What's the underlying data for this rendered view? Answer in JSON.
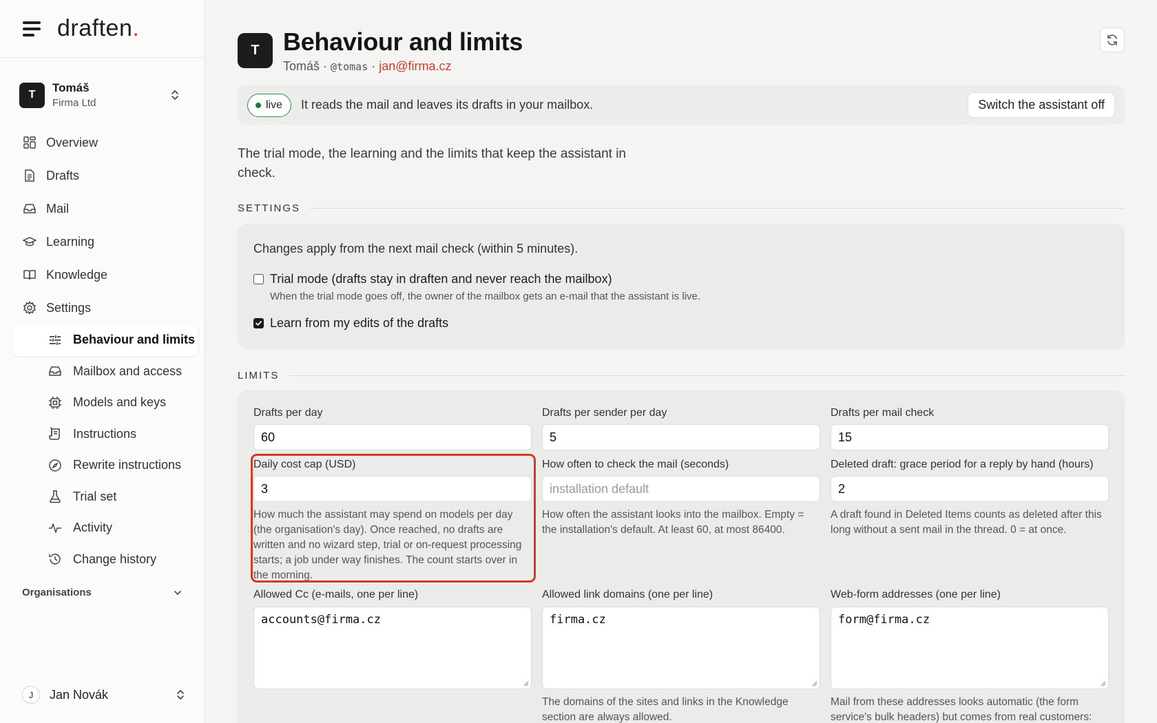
{
  "brand": {
    "name": "draften",
    "dot": ".",
    "accent": "#c8402b"
  },
  "account": {
    "initial": "T",
    "name": "Tomáš",
    "org": "Firma Ltd"
  },
  "nav": [
    {
      "label": "Overview",
      "icon": "grid-icon"
    },
    {
      "label": "Drafts",
      "icon": "document-icon"
    },
    {
      "label": "Mail",
      "icon": "inbox-icon"
    },
    {
      "label": "Learning",
      "icon": "graduation-cap-icon"
    },
    {
      "label": "Knowledge",
      "icon": "book-icon"
    },
    {
      "label": "Settings",
      "icon": "gear-icon"
    }
  ],
  "settings_nav": [
    {
      "label": "Behaviour and limits",
      "icon": "sliders-icon",
      "active": true
    },
    {
      "label": "Mailbox and access",
      "icon": "inbox-icon"
    },
    {
      "label": "Models and keys",
      "icon": "cpu-icon"
    },
    {
      "label": "Instructions",
      "icon": "scroll-icon"
    },
    {
      "label": "Rewrite instructions",
      "icon": "compass-icon"
    },
    {
      "label": "Trial set",
      "icon": "flask-icon"
    },
    {
      "label": "Activity",
      "icon": "activity-icon"
    },
    {
      "label": "Change history",
      "icon": "history-icon"
    }
  ],
  "organisations_label": "Organisations",
  "user": {
    "initial": "J",
    "name": "Jan Novák"
  },
  "header": {
    "initial": "T",
    "title": "Behaviour and limits",
    "name": "Tomáš",
    "sep": "·",
    "handle": "@tomas",
    "email": "jan@firma.cz"
  },
  "status": {
    "badge": "live",
    "text": "It reads the mail and leaves its drafts in your mailbox.",
    "button": "Switch the assistant off"
  },
  "intro": "The trial mode, the learning and the limits that keep the assistant in check.",
  "settings": {
    "section": "SETTINGS",
    "note": "Changes apply from the next mail check (within 5 minutes).",
    "trial": {
      "label": "Trial mode (drafts stay in draften and never reach the mailbox)",
      "hint": "When the trial mode goes off, the owner of the mailbox gets an e-mail that the assistant is live.",
      "checked": false
    },
    "learn": {
      "label": "Learn from my edits of the drafts",
      "checked": true
    }
  },
  "limits": {
    "section": "LIMITS",
    "drafts_per_day": {
      "label": "Drafts per day",
      "value": "60"
    },
    "drafts_per_sender": {
      "label": "Drafts per sender per day",
      "value": "5"
    },
    "drafts_per_check": {
      "label": "Drafts per mail check",
      "value": "15"
    },
    "daily_cost": {
      "label": "Daily cost cap (USD)",
      "value": "3",
      "help": "How much the assistant may spend on models per day (the organisation's day). Once reached, no drafts are written and no wizard step, trial or on-request processing starts; a job under way finishes. The count starts over in the morning."
    },
    "check_interval": {
      "label": "How often to check the mail (seconds)",
      "placeholder": "installation default",
      "help": "How often the assistant looks into the mailbox. Empty = the installation's default. At least 60, at most 86400."
    },
    "grace_period": {
      "label": "Deleted draft: grace period for a reply by hand (hours)",
      "value": "2",
      "help": "A draft found in Deleted Items counts as deleted after this long without a sent mail in the thread. 0 = at once."
    },
    "allowed_cc": {
      "label": "Allowed Cc (e-mails, one per line)",
      "value": "accounts@firma.cz"
    },
    "allowed_domains": {
      "label": "Allowed link domains (one per line)",
      "value": "firma.cz",
      "help": "The domains of the sites and links in the Knowledge section are always allowed."
    },
    "webform": {
      "label": "Web-form addresses (one per line)",
      "value": "form@firma.cz",
      "help": "Mail from these addresses looks automatic (the form service's bulk headers) but comes from real customers:"
    }
  },
  "colors": {
    "live_green": "#2f8a4b",
    "highlight_red": "#d23a26"
  }
}
